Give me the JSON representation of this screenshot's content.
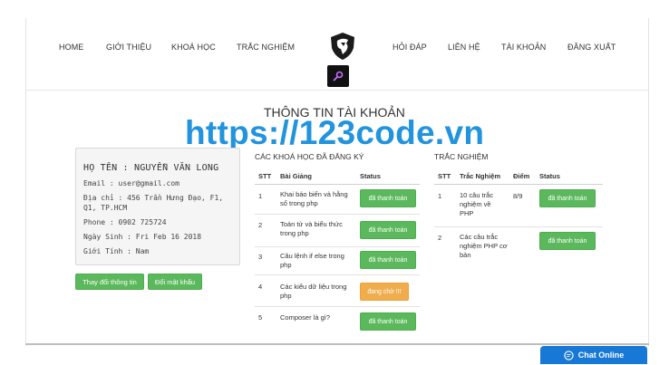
{
  "nav": {
    "left": [
      "HOME",
      "GIỚI THIỆU",
      "KHOÁ HỌC",
      "TRẮC NGHIỆM"
    ],
    "right": [
      "HỎI ĐÁP",
      "LIÊN HỆ",
      "TÀI KHOẢN",
      "ĐĂNG XUẤT"
    ]
  },
  "page_title": "THÔNG TIN TÀI KHOẢN",
  "watermark": "https://123code.vn",
  "profile": {
    "name": "HỌ TÊN : NGUYỄN VĂN LONG",
    "email": "Email : user@gmail.com",
    "address": "Địa chỉ : 456 Trần Hưng Đạo, F1, Q1, TP.HCM",
    "phone": "Phone : 0902 725724",
    "birthday": "Ngày Sinh : Fri Feb 16 2018",
    "gender": "Giới Tính : Nam"
  },
  "buttons": {
    "edit": "Thay đổi thông tin",
    "password": "Đổi mật khẩu"
  },
  "courses": {
    "title": "CÁC KHOÁ HỌC ĐÃ ĐĂNG KÝ",
    "headers": [
      "STT",
      "Bài Giảng",
      "Status"
    ],
    "rows": [
      {
        "stt": "1",
        "name": "Khai báo biến và hằng số trong php",
        "status": "đã thanh toán",
        "kind": "paid"
      },
      {
        "stt": "2",
        "name": "Toán tử và biểu thức trong php",
        "status": "đã thanh toán",
        "kind": "paid"
      },
      {
        "stt": "3",
        "name": "Câu lệnh if else trong php",
        "status": "đã thanh toán",
        "kind": "paid"
      },
      {
        "stt": "4",
        "name": "Các kiểu dữ liệu trong php",
        "status": "đang chờ !!!",
        "kind": "pending"
      },
      {
        "stt": "5",
        "name": "Composer là gì?",
        "status": "đã thanh toán",
        "kind": "paid"
      }
    ]
  },
  "quiz": {
    "title": "TRẮC NGHIỆM",
    "headers": [
      "STT",
      "Trắc Nghiệm",
      "Điểm",
      "Status"
    ],
    "rows": [
      {
        "stt": "1",
        "name": "10 câu trắc nghiệm về PHP",
        "score": "8/9",
        "status": "đã thanh toán"
      },
      {
        "stt": "2",
        "name": "Các câu trắc nghiệm PHP cơ bản",
        "score": "",
        "status": "đã thanh toán"
      }
    ]
  },
  "chat": {
    "label": "Chat Online",
    "icon": "chat-bubble-icon"
  },
  "colors": {
    "success": "#5cb85c",
    "warning": "#f0ad4e",
    "chat": "#1778d6",
    "watermark": "#1a8fdc"
  }
}
